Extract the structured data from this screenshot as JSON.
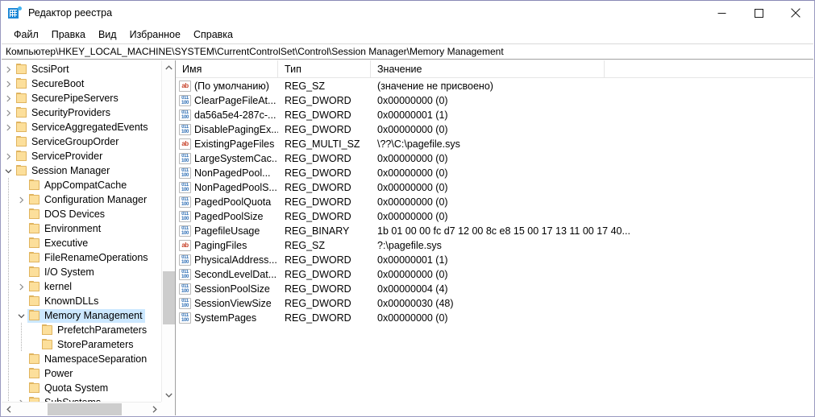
{
  "window": {
    "title": "Редактор реестра",
    "icon": "registry-editor-icon",
    "minimize_label": "—",
    "maximize_label": "□",
    "close_label": "✕"
  },
  "menubar": {
    "items": [
      {
        "label": "Файл"
      },
      {
        "label": "Правка"
      },
      {
        "label": "Вид"
      },
      {
        "label": "Избранное"
      },
      {
        "label": "Справка"
      }
    ]
  },
  "address": {
    "path": "Компьютер\\HKEY_LOCAL_MACHINE\\SYSTEM\\CurrentControlSet\\Control\\Session Manager\\Memory Management"
  },
  "tree": {
    "items": [
      {
        "label": "ScsiPort",
        "depth": 1,
        "twisty": "collapsed",
        "selected": false
      },
      {
        "label": "SecureBoot",
        "depth": 1,
        "twisty": "collapsed",
        "selected": false
      },
      {
        "label": "SecurePipeServers",
        "depth": 1,
        "twisty": "collapsed",
        "selected": false
      },
      {
        "label": "SecurityProviders",
        "depth": 1,
        "twisty": "collapsed",
        "selected": false
      },
      {
        "label": "ServiceAggregatedEvents",
        "depth": 1,
        "twisty": "collapsed",
        "selected": false
      },
      {
        "label": "ServiceGroupOrder",
        "depth": 1,
        "twisty": "none",
        "selected": false
      },
      {
        "label": "ServiceProvider",
        "depth": 1,
        "twisty": "collapsed",
        "selected": false
      },
      {
        "label": "Session Manager",
        "depth": 1,
        "twisty": "expanded",
        "selected": false
      },
      {
        "label": "AppCompatCache",
        "depth": 2,
        "twisty": "none",
        "selected": false
      },
      {
        "label": "Configuration Manager",
        "depth": 2,
        "twisty": "collapsed",
        "selected": false
      },
      {
        "label": "DOS Devices",
        "depth": 2,
        "twisty": "none",
        "selected": false
      },
      {
        "label": "Environment",
        "depth": 2,
        "twisty": "none",
        "selected": false
      },
      {
        "label": "Executive",
        "depth": 2,
        "twisty": "none",
        "selected": false
      },
      {
        "label": "FileRenameOperations",
        "depth": 2,
        "twisty": "none",
        "selected": false
      },
      {
        "label": "I/O System",
        "depth": 2,
        "twisty": "none",
        "selected": false
      },
      {
        "label": "kernel",
        "depth": 2,
        "twisty": "collapsed",
        "selected": false
      },
      {
        "label": "KnownDLLs",
        "depth": 2,
        "twisty": "none",
        "selected": false
      },
      {
        "label": "Memory Management",
        "depth": 2,
        "twisty": "expanded",
        "selected": true
      },
      {
        "label": "PrefetchParameters",
        "depth": 3,
        "twisty": "none",
        "selected": false
      },
      {
        "label": "StoreParameters",
        "depth": 3,
        "twisty": "none",
        "selected": false
      },
      {
        "label": "NamespaceSeparation",
        "depth": 2,
        "twisty": "none",
        "selected": false
      },
      {
        "label": "Power",
        "depth": 2,
        "twisty": "none",
        "selected": false
      },
      {
        "label": "Quota System",
        "depth": 2,
        "twisty": "none",
        "selected": false
      },
      {
        "label": "SubSystems",
        "depth": 2,
        "twisty": "collapsed",
        "selected": false
      }
    ]
  },
  "list": {
    "columns": [
      {
        "label": "Имя"
      },
      {
        "label": "Тип"
      },
      {
        "label": "Значение"
      }
    ],
    "rows": [
      {
        "icon": "string-value-icon",
        "name": "(По умолчанию)",
        "type": "REG_SZ",
        "value": "(значение не присвоено)"
      },
      {
        "icon": "dword-value-icon",
        "name": "ClearPageFileAt...",
        "type": "REG_DWORD",
        "value": "0x00000000 (0)"
      },
      {
        "icon": "dword-value-icon",
        "name": "da56a5e4-287c-...",
        "type": "REG_DWORD",
        "value": "0x00000001 (1)"
      },
      {
        "icon": "dword-value-icon",
        "name": "DisablePagingEx...",
        "type": "REG_DWORD",
        "value": "0x00000000 (0)"
      },
      {
        "icon": "string-value-icon",
        "name": "ExistingPageFiles",
        "type": "REG_MULTI_SZ",
        "value": "\\??\\C:\\pagefile.sys"
      },
      {
        "icon": "dword-value-icon",
        "name": "LargeSystemCac...",
        "type": "REG_DWORD",
        "value": "0x00000000 (0)"
      },
      {
        "icon": "dword-value-icon",
        "name": "NonPagedPool...",
        "type": "REG_DWORD",
        "value": "0x00000000 (0)"
      },
      {
        "icon": "dword-value-icon",
        "name": "NonPagedPoolS...",
        "type": "REG_DWORD",
        "value": "0x00000000 (0)"
      },
      {
        "icon": "dword-value-icon",
        "name": "PagedPoolQuota",
        "type": "REG_DWORD",
        "value": "0x00000000 (0)"
      },
      {
        "icon": "dword-value-icon",
        "name": "PagedPoolSize",
        "type": "REG_DWORD",
        "value": "0x00000000 (0)"
      },
      {
        "icon": "dword-value-icon",
        "name": "PagefileUsage",
        "type": "REG_BINARY",
        "value": "1b 01 00 00 fc d7 12 00 8c e8 15 00 17 13 11 00 17 40..."
      },
      {
        "icon": "string-value-icon",
        "name": "PagingFiles",
        "type": "REG_SZ",
        "value": "?:\\pagefile.sys"
      },
      {
        "icon": "dword-value-icon",
        "name": "PhysicalAddress...",
        "type": "REG_DWORD",
        "value": "0x00000001 (1)"
      },
      {
        "icon": "dword-value-icon",
        "name": "SecondLevelDat...",
        "type": "REG_DWORD",
        "value": "0x00000000 (0)"
      },
      {
        "icon": "dword-value-icon",
        "name": "SessionPoolSize",
        "type": "REG_DWORD",
        "value": "0x00000004 (4)"
      },
      {
        "icon": "dword-value-icon",
        "name": "SessionViewSize",
        "type": "REG_DWORD",
        "value": "0x00000030 (48)"
      },
      {
        "icon": "dword-value-icon",
        "name": "SystemPages",
        "type": "REG_DWORD",
        "value": "0x00000000 (0)"
      }
    ]
  },
  "colors": {
    "selection": "#cce8ff",
    "folder": "#fcdf9b",
    "folder_border": "#e0b45f",
    "string_icon": "#c8442c",
    "dword_icon": "#2f6fb5",
    "window_border": "#9a9ac0",
    "scrollbar_thumb": "#cdcdcd"
  }
}
